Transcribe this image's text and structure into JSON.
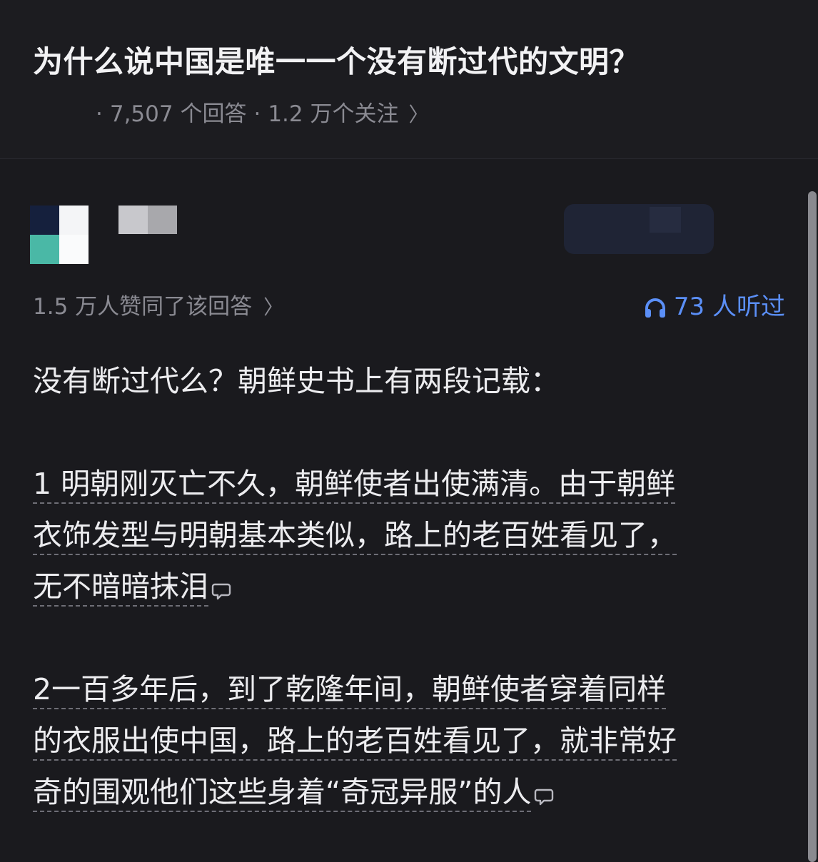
{
  "question": {
    "title": "为什么说中国是唯一一个没有断过代的文明？",
    "answers_count": "7,507 个回答",
    "followers_count": "1.2 万个关注"
  },
  "answer": {
    "likes_text": "1.5 万人赞同了该回答",
    "listen_text": "73 人听过",
    "paragraphs": {
      "intro": "没有断过代么？朝鲜史书上有两段记载：",
      "p1_line1": "1 明朝刚灭亡不久，朝鲜使者出使满清。由于朝鲜",
      "p1_line2": "衣饰发型与明朝基本类似，路上的老百姓看见了，",
      "p1_line3": "无不暗暗抹泪",
      "p2_line1": "2一百多年后，到了乾隆年间，朝鲜使者穿着同样",
      "p2_line2": "的衣服出使中国，路上的老百姓看见了，就非常好",
      "p2_line3": "奇的围观他们这些身着“奇冠异服”的人"
    }
  },
  "colors": {
    "background": "#1a1a1e",
    "accent_blue": "#5b8ff7",
    "muted_text": "#8a8a92"
  }
}
